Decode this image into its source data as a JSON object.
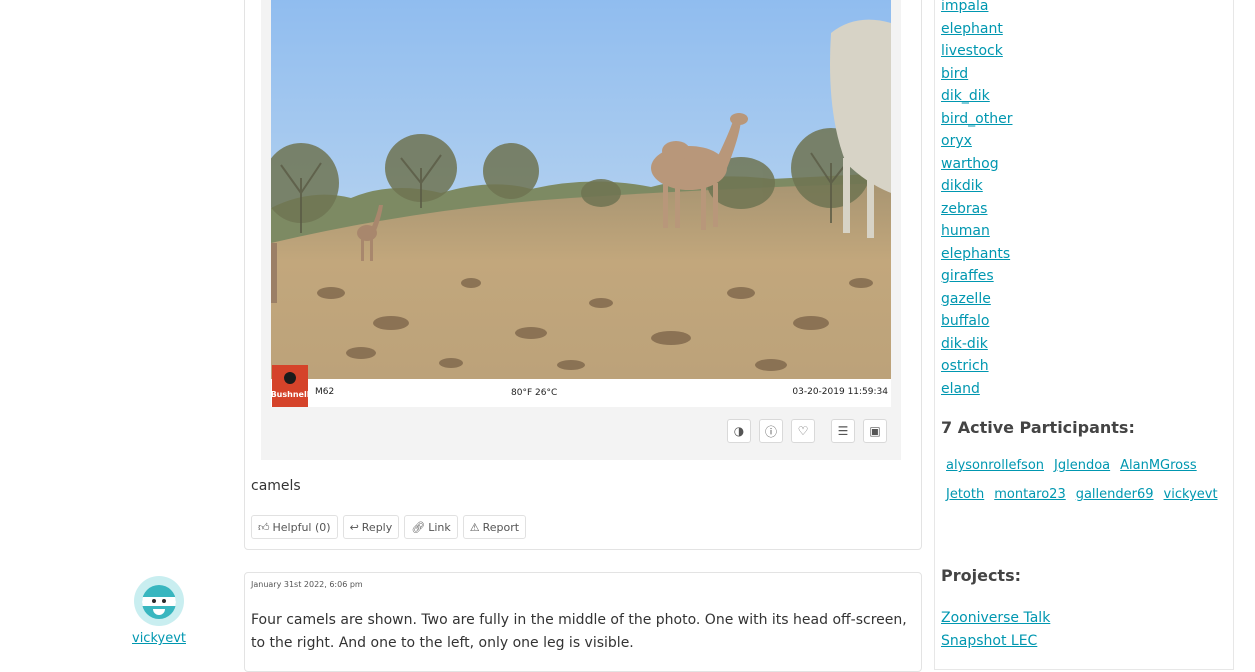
{
  "comment1": {
    "body": "camels",
    "photo": {
      "brand": "Bushnell",
      "camera_id": "M62",
      "temperature": "80°F  26°C",
      "datetime": "03-20-2019 11:59:34"
    },
    "tools": [
      "invert-colors",
      "subject-info",
      "favorite",
      "add-to-collection",
      "view-subject"
    ],
    "actions": {
      "helpful": "Helpful (0)",
      "reply": "Reply",
      "link": "Link",
      "report": "Report"
    }
  },
  "comment2": {
    "author": "vickyevt",
    "timestamp": "January 31st 2022, 6:06 pm",
    "body": "Four camels are shown. Two are fully in the middle of the photo. One with its head off-screen, to the right. And one to the left, only one leg is visible."
  },
  "sidebar": {
    "tags": [
      "impala",
      "elephant",
      "livestock",
      "bird",
      "dik_dik",
      "bird_other",
      "oryx",
      "warthog",
      "dikdik",
      "zebras",
      "human",
      "elephants",
      "giraffes",
      "gazelle",
      "buffalo",
      "dik-dik",
      "ostrich",
      "eland"
    ],
    "participants_heading": "7 Active Participants:",
    "participants": [
      "alysonrollefson",
      "Jglendoa",
      "AlanMGross",
      "Jetoth",
      "montaro23",
      "gallender69",
      "vickyevt"
    ],
    "projects_heading": "Projects:",
    "projects": [
      "Zooniverse Talk",
      "Snapshot LEC"
    ]
  },
  "colors": {
    "link": "#0097b0",
    "sky": "#aacdf0",
    "ground": "#b99f76",
    "avatar": "#38b6bf"
  }
}
